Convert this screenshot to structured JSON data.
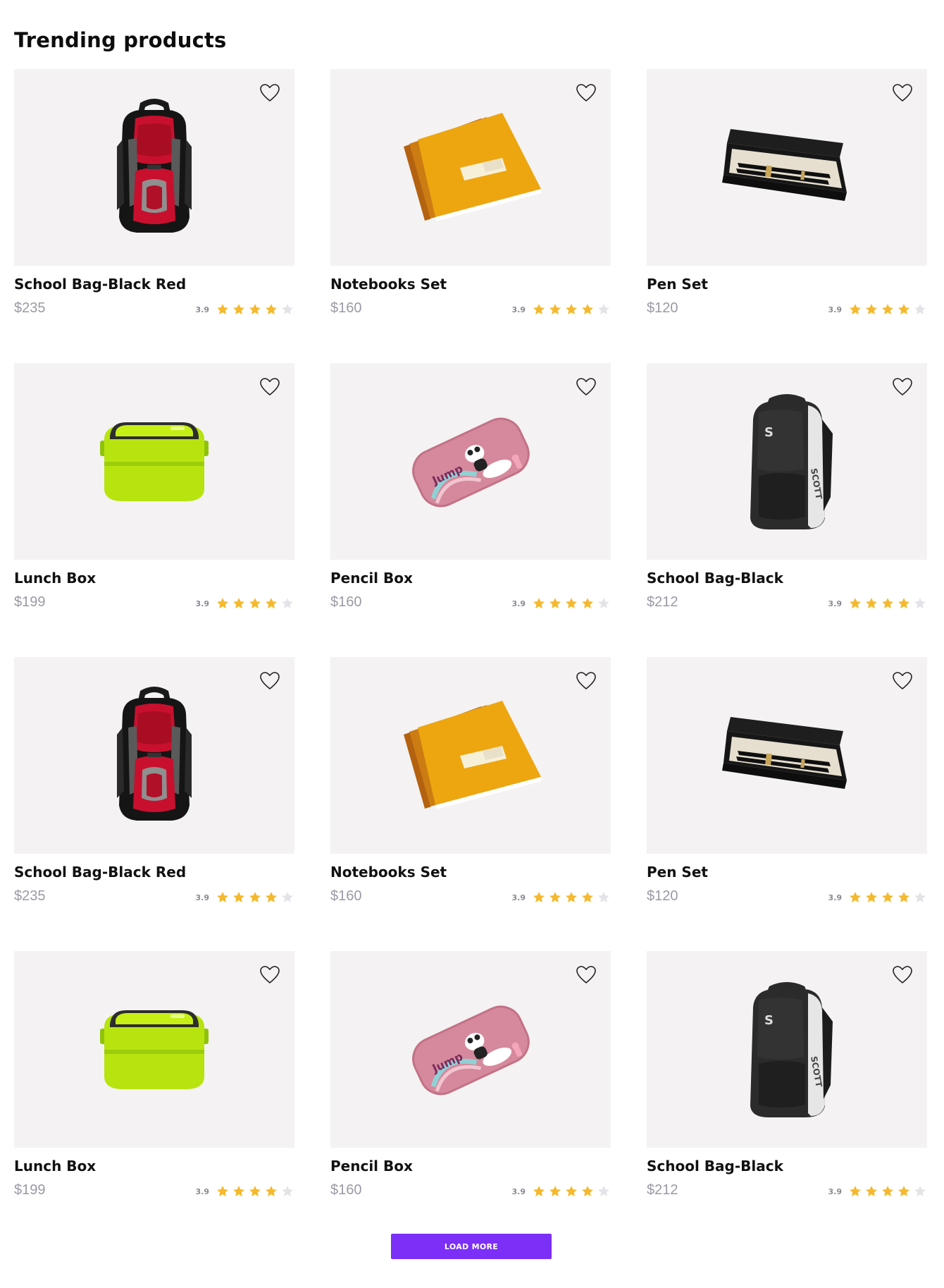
{
  "section": {
    "title": "Trending products"
  },
  "products": [
    {
      "name": "School Bag-Black Red",
      "price": "$235",
      "rating": "3.9",
      "stars_filled": 4,
      "icon": "red-backpack-image"
    },
    {
      "name": "Notebooks Set",
      "price": "$160",
      "rating": "3.9",
      "stars_filled": 4,
      "icon": "notebook-set-image"
    },
    {
      "name": "Pen Set",
      "price": "$120",
      "rating": "3.9",
      "stars_filled": 4,
      "icon": "pen-set-image"
    },
    {
      "name": "Lunch Box",
      "price": "$199",
      "rating": "3.9",
      "stars_filled": 4,
      "icon": "lunch-box-image"
    },
    {
      "name": "Pencil Box",
      "price": "$160",
      "rating": "3.9",
      "stars_filled": 4,
      "icon": "pencil-box-image"
    },
    {
      "name": "School Bag-Black",
      "price": "$212",
      "rating": "3.9",
      "stars_filled": 4,
      "icon": "black-backpack-image"
    },
    {
      "name": "School Bag-Black Red",
      "price": "$235",
      "rating": "3.9",
      "stars_filled": 4,
      "icon": "red-backpack-image"
    },
    {
      "name": "Notebooks Set",
      "price": "$160",
      "rating": "3.9",
      "stars_filled": 4,
      "icon": "notebook-set-image"
    },
    {
      "name": "Pen Set",
      "price": "$120",
      "rating": "3.9",
      "stars_filled": 4,
      "icon": "pen-set-image"
    },
    {
      "name": "Lunch Box",
      "price": "$199",
      "rating": "3.9",
      "stars_filled": 4,
      "icon": "lunch-box-image"
    },
    {
      "name": "Pencil Box",
      "price": "$160",
      "rating": "3.9",
      "stars_filled": 4,
      "icon": "pencil-box-image"
    },
    {
      "name": "School Bag-Black",
      "price": "$212",
      "rating": "3.9",
      "stars_filled": 4,
      "icon": "black-backpack-image"
    }
  ],
  "load_more": {
    "label": "LOAD MORE"
  },
  "colors": {
    "accent": "#7b2ff7",
    "star_filled": "#f5b92e",
    "star_empty": "#e4e4e8",
    "card_bg": "#f4f2f3",
    "price": "#9a9aa6"
  }
}
